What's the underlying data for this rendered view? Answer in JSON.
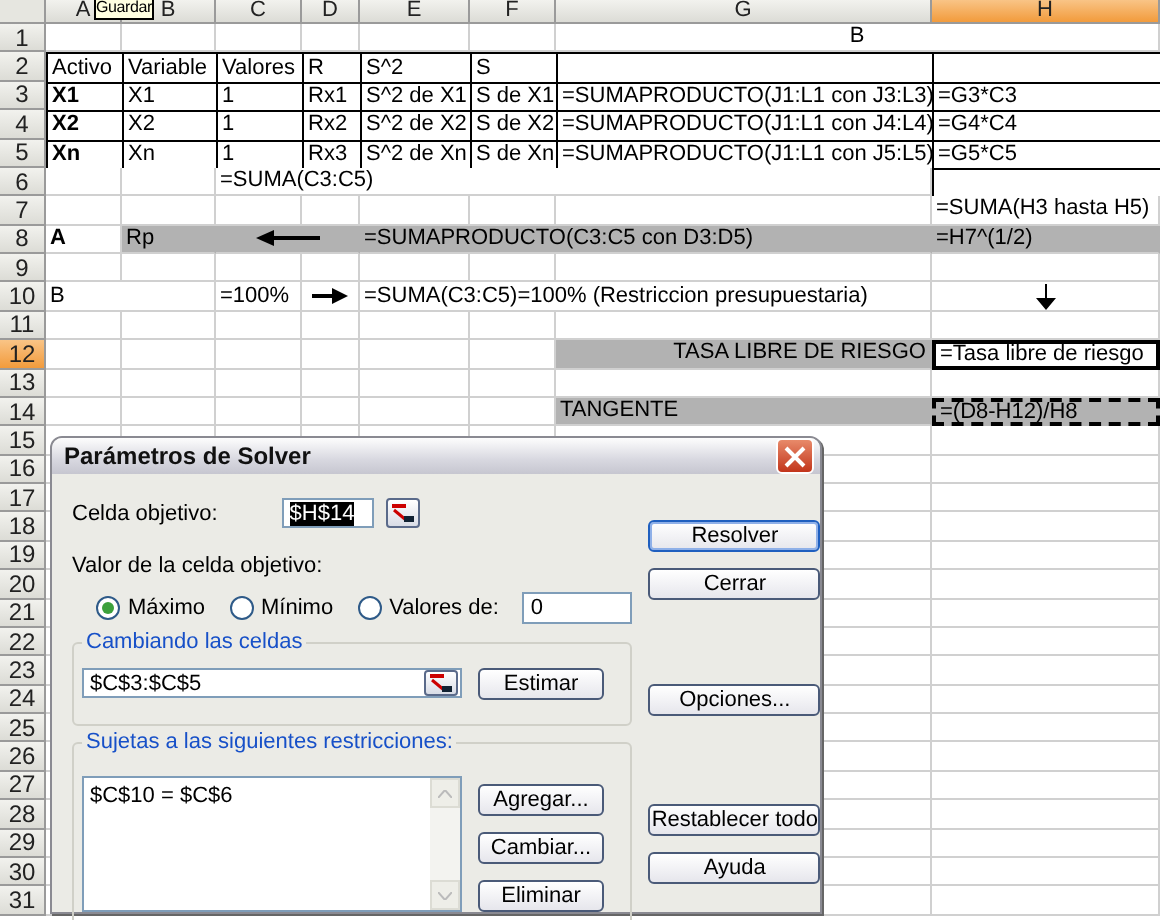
{
  "tooltip": {
    "text": "Guardar"
  },
  "columns": [
    {
      "label": "A",
      "selected": false
    },
    {
      "label": "B",
      "selected": false
    },
    {
      "label": "C",
      "selected": false
    },
    {
      "label": "D",
      "selected": false
    },
    {
      "label": "E",
      "selected": false
    },
    {
      "label": "F",
      "selected": false
    },
    {
      "label": "G",
      "selected": false
    },
    {
      "label": "H",
      "selected": true
    }
  ],
  "rows": [
    {
      "number": "1",
      "selected": false,
      "cells": [
        {
          "kind": "empty"
        },
        {
          "kind": "empty"
        },
        {
          "kind": "empty"
        },
        {
          "kind": "empty"
        },
        {
          "kind": "empty"
        },
        {
          "kind": "empty"
        },
        {
          "kind": "text",
          "text": "B",
          "centered": true
        },
        {
          "kind": "empty"
        }
      ]
    },
    {
      "number": "2",
      "selected": false,
      "cells": [
        {
          "kind": "text",
          "text": "Activo",
          "boxed": true
        },
        {
          "kind": "text",
          "text": "Variable",
          "boxed": true
        },
        {
          "kind": "text",
          "text": "Valores",
          "boxed": true
        },
        {
          "kind": "text",
          "text": "R",
          "boxed": true
        },
        {
          "kind": "text",
          "text": "S^2",
          "boxed": true
        },
        {
          "kind": "text",
          "text": "S",
          "boxed": true
        },
        {
          "kind": "empty",
          "boxed": true
        },
        {
          "kind": "empty",
          "boxed": true
        }
      ]
    },
    {
      "number": "3",
      "selected": false,
      "cells": [
        {
          "kind": "text",
          "text": "X1",
          "bold": true,
          "boxed": true
        },
        {
          "kind": "text",
          "text": "X1",
          "boxed": true
        },
        {
          "kind": "text",
          "text": "1",
          "boxed": true
        },
        {
          "kind": "text",
          "text": "Rx1",
          "boxed": true
        },
        {
          "kind": "text",
          "text": "S^2 de X1",
          "boxed": true
        },
        {
          "kind": "text",
          "text": "S de X1",
          "boxed": true
        },
        {
          "kind": "text",
          "text": "=SUMAPRODUCTO(J1:L1 con J3:L3)",
          "boxed": true
        },
        {
          "kind": "text",
          "text": "=G3*C3",
          "boxed": true
        }
      ]
    },
    {
      "number": "4",
      "selected": false,
      "cells": [
        {
          "kind": "text",
          "text": "X2",
          "bold": true,
          "boxed": true
        },
        {
          "kind": "text",
          "text": "X2",
          "boxed": true
        },
        {
          "kind": "text",
          "text": "1",
          "boxed": true
        },
        {
          "kind": "text",
          "text": "Rx2",
          "boxed": true
        },
        {
          "kind": "text",
          "text": "S^2 de X2",
          "boxed": true
        },
        {
          "kind": "text",
          "text": "S de X2",
          "boxed": true
        },
        {
          "kind": "text",
          "text": "=SUMAPRODUCTO(J1:L1 con J4:L4)",
          "boxed": true
        },
        {
          "kind": "text",
          "text": "=G4*C4",
          "boxed": true
        }
      ]
    },
    {
      "number": "5",
      "selected": false,
      "cells": [
        {
          "kind": "text",
          "text": "Xn",
          "bold": true,
          "boxed": true
        },
        {
          "kind": "text",
          "text": "Xn",
          "boxed": true
        },
        {
          "kind": "text",
          "text": "1",
          "boxed": true
        },
        {
          "kind": "text",
          "text": "Rx3",
          "boxed": true
        },
        {
          "kind": "text",
          "text": "S^2 de Xn",
          "boxed": true
        },
        {
          "kind": "text",
          "text": "S de Xn",
          "boxed": true
        },
        {
          "kind": "text",
          "text": "=SUMAPRODUCTO(J1:L1 con J5:L5)",
          "boxed": true
        },
        {
          "kind": "text",
          "text": "=G5*C5",
          "boxed": true
        }
      ]
    },
    {
      "number": "6",
      "selected": false,
      "cells": [
        {
          "kind": "empty"
        },
        {
          "kind": "empty"
        },
        {
          "kind": "text",
          "text": "=SUMA(C3:C5)"
        },
        {
          "kind": "empty"
        },
        {
          "kind": "empty"
        },
        {
          "kind": "empty"
        },
        {
          "kind": "empty"
        },
        {
          "kind": "empty",
          "boxed": true
        }
      ]
    },
    {
      "number": "7",
      "selected": false,
      "cells": [
        {
          "kind": "empty"
        },
        {
          "kind": "empty"
        },
        {
          "kind": "empty"
        },
        {
          "kind": "empty"
        },
        {
          "kind": "empty"
        },
        {
          "kind": "empty"
        },
        {
          "kind": "empty"
        },
        {
          "kind": "text",
          "text": "=SUMA(H3 hasta H5)"
        }
      ]
    },
    {
      "number": "8",
      "selected": false,
      "cells": [
        {
          "kind": "text",
          "text": "A",
          "bold": true
        },
        {
          "kind": "text",
          "text": "Rp",
          "shaded": true
        },
        {
          "kind": "arrow-left",
          "shaded": true
        },
        {
          "kind": "empty"
        },
        {
          "kind": "text",
          "text": "=SUMAPRODUCTO(C3:C5 con D3:D5)",
          "shaded": true
        },
        {
          "kind": "empty"
        },
        {
          "kind": "empty"
        },
        {
          "kind": "text",
          "text": "=H7^(1/2)",
          "shaded": true
        }
      ]
    },
    {
      "number": "9",
      "selected": false
    },
    {
      "number": "10",
      "selected": false,
      "cells": [
        {
          "kind": "text",
          "text": "B"
        },
        {
          "kind": "empty"
        },
        {
          "kind": "text",
          "text": "=100%"
        },
        {
          "kind": "arrow-right"
        },
        {
          "kind": "text",
          "text": "=SUMA(C3:C5)=100% (Restriccion presupuestaria)"
        },
        {
          "kind": "empty"
        },
        {
          "kind": "empty"
        },
        {
          "kind": "arrow-down"
        }
      ]
    },
    {
      "number": "11",
      "selected": false
    },
    {
      "number": "12",
      "selected": true,
      "cells": [
        {
          "kind": "empty"
        },
        {
          "kind": "empty"
        },
        {
          "kind": "empty"
        },
        {
          "kind": "empty"
        },
        {
          "kind": "empty"
        },
        {
          "kind": "empty"
        },
        {
          "kind": "text",
          "text": "TASA LIBRE DE RIESGO",
          "right_aligned": true,
          "shaded": true
        },
        {
          "kind": "text",
          "text": "=Tasa libre de riesgo",
          "thick_border": true
        }
      ]
    },
    {
      "number": "13",
      "selected": false
    },
    {
      "number": "14",
      "selected": false,
      "cells": [
        {
          "kind": "empty"
        },
        {
          "kind": "empty"
        },
        {
          "kind": "empty"
        },
        {
          "kind": "empty"
        },
        {
          "kind": "empty"
        },
        {
          "kind": "empty"
        },
        {
          "kind": "text",
          "text": "TANGENTE",
          "shaded": true
        },
        {
          "kind": "text",
          "text": "=(D8-H12)/H8",
          "shaded": true,
          "dashed_border": true
        }
      ]
    },
    {
      "number": "15",
      "selected": false
    },
    {
      "number": "16",
      "selected": false
    },
    {
      "number": "17",
      "selected": false
    },
    {
      "number": "18",
      "selected": false
    },
    {
      "number": "19",
      "selected": false
    },
    {
      "number": "20",
      "selected": false
    },
    {
      "number": "21",
      "selected": false
    },
    {
      "number": "22",
      "selected": false
    },
    {
      "number": "23",
      "selected": false
    },
    {
      "number": "24",
      "selected": false
    },
    {
      "number": "25",
      "selected": false
    },
    {
      "number": "26",
      "selected": false
    },
    {
      "number": "27",
      "selected": false
    },
    {
      "number": "28",
      "selected": false
    },
    {
      "number": "29",
      "selected": false
    },
    {
      "number": "30",
      "selected": false
    },
    {
      "number": "31",
      "selected": false
    }
  ],
  "dialog": {
    "title": "Parámetros de Solver",
    "target": {
      "label": "Celda objetivo:",
      "value": "$H$14",
      "text_selected": true
    },
    "value_label": "Valor de la celda objetivo:",
    "options": [
      {
        "label": "Máximo",
        "selected": true
      },
      {
        "label": "Mínimo",
        "selected": false
      },
      {
        "label": "Valores de:",
        "selected": false
      }
    ],
    "value_field": "0",
    "changing": {
      "legend": "Cambiando las celdas",
      "value": "$C$3:$C$5",
      "button": "Estimar"
    },
    "constraints": {
      "legend": "Sujetas a las siguientes restricciones:",
      "items": [
        "$C$10 = $C$6"
      ],
      "buttons": [
        "Agregar...",
        "Cambiar...",
        "Eliminar"
      ]
    },
    "buttons": [
      {
        "label": "Resolver",
        "default": true
      },
      {
        "label": "Cerrar",
        "default": false
      },
      {
        "label": "Opciones...",
        "default": false
      },
      {
        "label": "Restablecer todo",
        "default": false
      },
      {
        "label": "Ayuda",
        "default": false
      }
    ]
  }
}
